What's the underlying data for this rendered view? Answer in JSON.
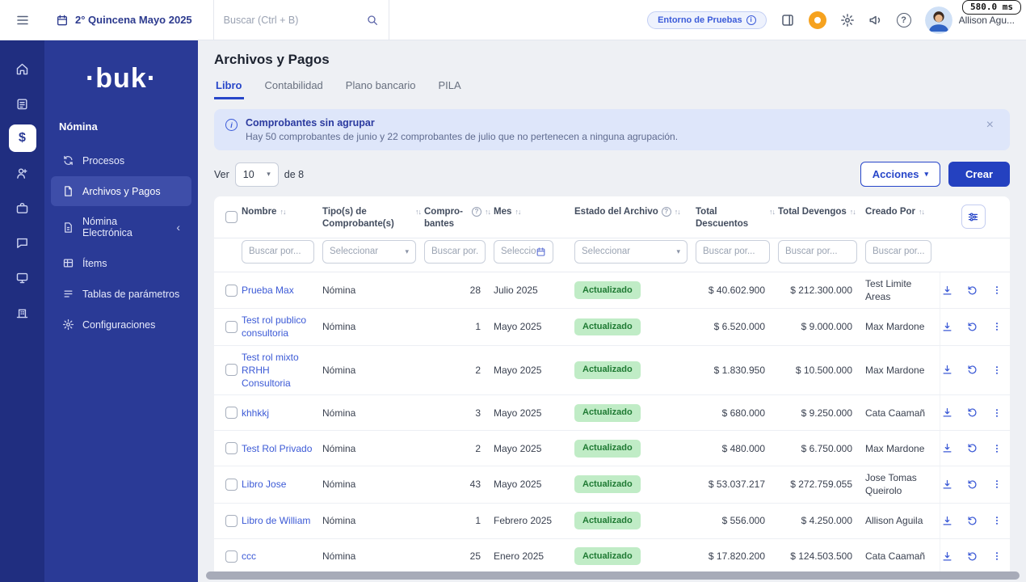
{
  "meta": {
    "latency_badge": "580.0 ms"
  },
  "icons": {
    "chevron_down": "▾",
    "chevron_left": "‹",
    "close": "×",
    "sort": "↑↓",
    "help": "?",
    "info": "i",
    "dollar": "$"
  },
  "topbar": {
    "period": "2° Quincena Mayo 2025",
    "search_placeholder": "Buscar (Ctrl + B)",
    "env_badge": "Entorno de Pruebas",
    "user_name": "Allison Agu..."
  },
  "sidebar": {
    "logo": "·buk·",
    "section_label": "Nómina",
    "items": [
      {
        "label": "Procesos"
      },
      {
        "label": "Archivos y Pagos"
      },
      {
        "label": "Nómina Electrónica"
      },
      {
        "label": "Ítems"
      },
      {
        "label": "Tablas de parámetros"
      },
      {
        "label": "Configuraciones"
      }
    ]
  },
  "main": {
    "title": "Archivos y Pagos",
    "tabs": [
      {
        "label": "Libro"
      },
      {
        "label": "Contabilidad"
      },
      {
        "label": "Plano bancario"
      },
      {
        "label": "PILA"
      }
    ],
    "banner": {
      "title": "Comprobantes sin agrupar",
      "message": "Hay 50 comprobantes de junio y 22 comprobantes de julio que no pertenecen a ninguna agrupación."
    },
    "pager": {
      "ver": "Ver",
      "page_size": "10",
      "de": "de 8"
    },
    "buttons": {
      "acciones": "Acciones",
      "crear": "Crear"
    },
    "table": {
      "headers": {
        "nombre": "Nombre",
        "tipo": "Tipo(s) de Comprobante(s)",
        "comprobantes": "Compro-bantes",
        "mes": "Mes",
        "estado": "Estado del Archivo",
        "descuentos": "Total Descuentos",
        "devengos": "Total Devengos",
        "creado": "Creado Por"
      },
      "filters": {
        "buscar": "Buscar por...",
        "seleccionar": "Seleccionar",
        "mes": "Seleccio"
      },
      "rows": [
        {
          "name": "Prueba Max",
          "tipo": "Nómina",
          "comprobantes": "28",
          "mes": "Julio 2025",
          "estado": "Actualizado",
          "descuentos": "$ 40.602.900",
          "devengos": "$ 212.300.000",
          "creado": "Test Limite Areas"
        },
        {
          "name": "Test rol publico consultoria",
          "tipo": "Nómina",
          "comprobantes": "1",
          "mes": "Mayo 2025",
          "estado": "Actualizado",
          "descuentos": "$ 6.520.000",
          "devengos": "$ 9.000.000",
          "creado": "Max Mardone"
        },
        {
          "name": "Test rol mixto RRHH Consultoria",
          "tipo": "Nómina",
          "comprobantes": "2",
          "mes": "Mayo 2025",
          "estado": "Actualizado",
          "descuentos": "$ 1.830.950",
          "devengos": "$ 10.500.000",
          "creado": "Max Mardone"
        },
        {
          "name": "khhkkj",
          "tipo": "Nómina",
          "comprobantes": "3",
          "mes": "Mayo 2025",
          "estado": "Actualizado",
          "descuentos": "$ 680.000",
          "devengos": "$ 9.250.000",
          "creado": "Cata Caamañ"
        },
        {
          "name": "Test Rol Privado",
          "tipo": "Nómina",
          "comprobantes": "2",
          "mes": "Mayo 2025",
          "estado": "Actualizado",
          "descuentos": "$ 480.000",
          "devengos": "$ 6.750.000",
          "creado": "Max Mardone"
        },
        {
          "name": "Libro Jose",
          "tipo": "Nómina",
          "comprobantes": "43",
          "mes": "Mayo 2025",
          "estado": "Actualizado",
          "descuentos": "$ 53.037.217",
          "devengos": "$ 272.759.055",
          "creado": "Jose Tomas Queirolo"
        },
        {
          "name": "Libro de William",
          "tipo": "Nómina",
          "comprobantes": "1",
          "mes": "Febrero 2025",
          "estado": "Actualizado",
          "descuentos": "$ 556.000",
          "devengos": "$ 4.250.000",
          "creado": "Allison Aguila"
        },
        {
          "name": "ccc",
          "tipo": "Nómina",
          "comprobantes": "25",
          "mes": "Enero 2025",
          "estado": "Actualizado",
          "descuentos": "$ 17.820.200",
          "devengos": "$ 124.503.500",
          "creado": "Cata Caamañ"
        }
      ]
    }
  }
}
